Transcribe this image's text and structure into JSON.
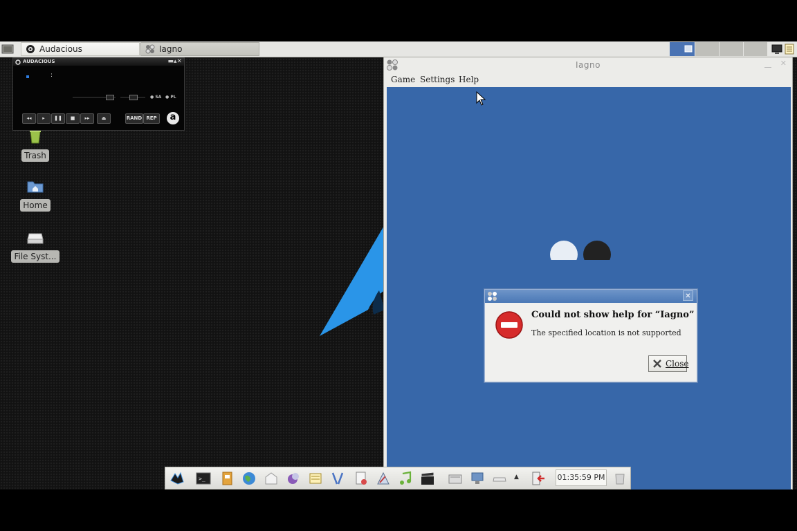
{
  "taskbar": {
    "tasks": [
      {
        "label": "Audacious"
      },
      {
        "label": "Iagno"
      }
    ]
  },
  "desktop": {
    "icons": [
      {
        "label": "Trash"
      },
      {
        "label": "Home"
      },
      {
        "label": "File Syst..."
      }
    ]
  },
  "audacious": {
    "title": "AUDACIOUS",
    "time_separator": ":",
    "sa_label": "SA",
    "pl_label": "PL",
    "controls": [
      "◂◂",
      "▸",
      "❚❚",
      "■",
      "▸▸",
      "⏏"
    ],
    "rand_label": "RAND",
    "rep_label": "REP",
    "logo_letter": "a"
  },
  "iagno": {
    "title": "Iagno",
    "menu": [
      "Game",
      "Settings",
      "Help"
    ]
  },
  "dialog": {
    "title": "Could not show help for “Iagno”",
    "message": "The specified location is not supported",
    "close_label": "Close"
  },
  "panel": {
    "clock": "01:35:59 PM"
  },
  "colors": {
    "board": "#3767a9",
    "dialog_bar": "#5a86c0",
    "error_icon": "#d62b2b"
  }
}
